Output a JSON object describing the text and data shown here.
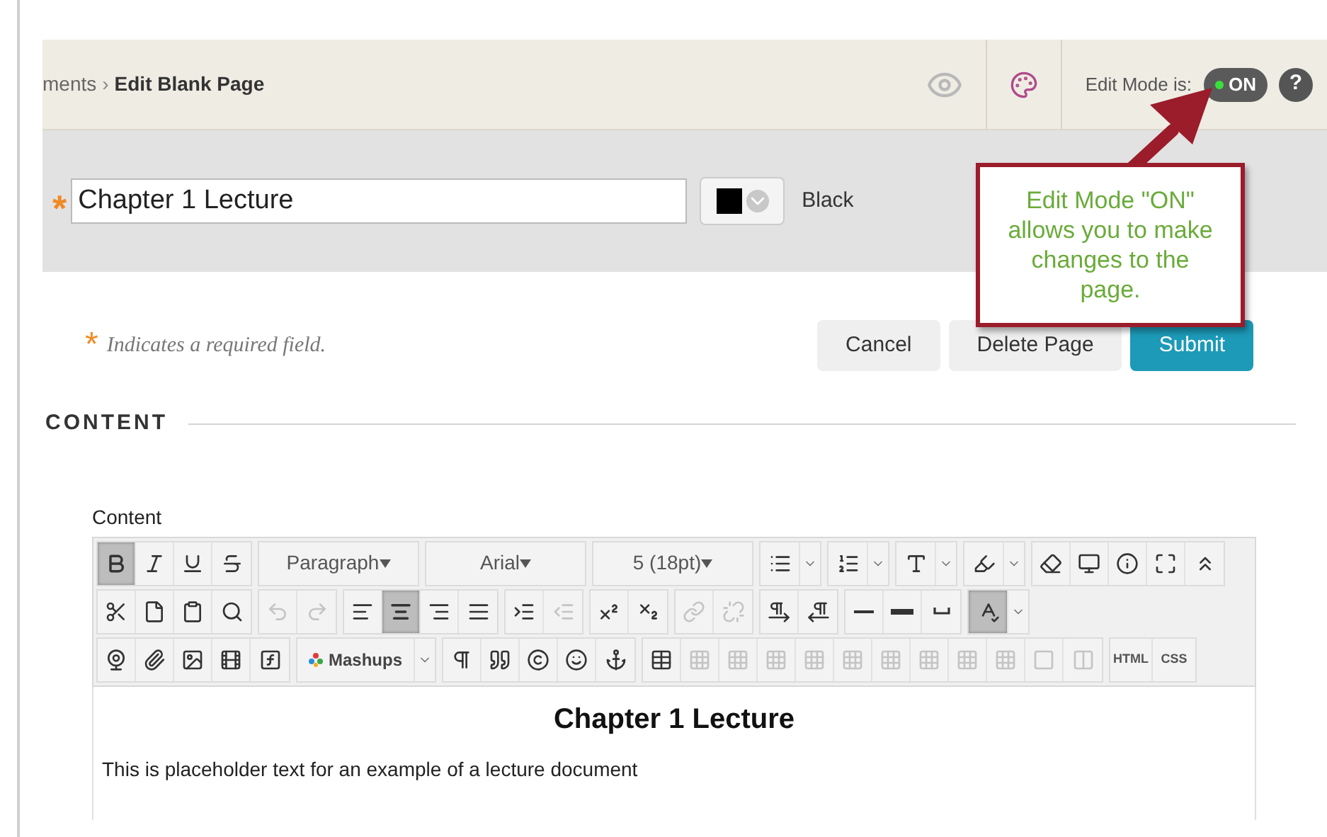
{
  "breadcrumb": {
    "parent": "ments",
    "separator": "›",
    "current": "Edit Blank Page"
  },
  "edit_mode": {
    "label": "Edit Mode is:",
    "on": true,
    "state_text": "ON"
  },
  "help": "?",
  "title_field": {
    "required_mark": "*",
    "value": "Chapter 1 Lecture"
  },
  "color_picker": {
    "color": "#000000",
    "label": "Black"
  },
  "required_note": {
    "mark": "*",
    "text": "Indicates a required field."
  },
  "buttons": [
    {
      "label": "Cancel",
      "kind": "secondary"
    },
    {
      "label": "Delete Page",
      "kind": "secondary"
    },
    {
      "label": "Submit",
      "kind": "primary"
    }
  ],
  "section_heading": "CONTENT",
  "editor": {
    "label": "Content",
    "toolbar": [
      [
        [
          {
            "kind": "icon",
            "pressed": true,
            "disabled": false
          },
          {
            "kind": "icon",
            "pressed": false,
            "disabled": false
          },
          {
            "kind": "icon",
            "pressed": false,
            "disabled": false
          },
          {
            "kind": "icon",
            "pressed": false,
            "disabled": false
          }
        ],
        [
          {
            "kind": "select",
            "label": "Paragraph"
          }
        ],
        [
          {
            "kind": "select",
            "label": "Arial"
          }
        ],
        [
          {
            "kind": "select",
            "label": "5 (18pt)"
          }
        ],
        [
          {
            "kind": "split",
            "pressed": false
          }
        ],
        [
          {
            "kind": "split",
            "pressed": false
          }
        ],
        [
          {
            "kind": "split",
            "pressed": false
          }
        ],
        [
          {
            "kind": "split",
            "pressed": false
          }
        ],
        [
          {
            "kind": "icon",
            "pressed": false,
            "disabled": false
          },
          {
            "kind": "icon",
            "pressed": false,
            "disabled": false
          },
          {
            "kind": "icon",
            "pressed": false,
            "disabled": false
          },
          {
            "kind": "icon",
            "pressed": false,
            "disabled": false
          },
          {
            "kind": "icon",
            "pressed": false,
            "disabled": false
          }
        ]
      ],
      [
        [
          {
            "kind": "icon",
            "pressed": false,
            "disabled": false
          },
          {
            "kind": "icon",
            "pressed": false,
            "disabled": false
          },
          {
            "kind": "icon",
            "pressed": false,
            "disabled": false
          },
          {
            "kind": "icon",
            "pressed": false,
            "disabled": false
          }
        ],
        [
          {
            "kind": "icon",
            "pressed": false,
            "disabled": true
          },
          {
            "kind": "icon",
            "pressed": false,
            "disabled": true
          }
        ],
        [
          {
            "kind": "icon",
            "pressed": false,
            "disabled": false
          },
          {
            "kind": "icon",
            "pressed": true,
            "disabled": false
          },
          {
            "kind": "icon",
            "pressed": false,
            "disabled": false
          },
          {
            "kind": "icon",
            "pressed": false,
            "disabled": false
          }
        ],
        [
          {
            "kind": "icon",
            "pressed": false,
            "disabled": false
          },
          {
            "kind": "icon",
            "pressed": false,
            "disabled": true
          }
        ],
        [
          {
            "kind": "icon",
            "pressed": false,
            "disabled": false
          },
          {
            "kind": "icon",
            "pressed": false,
            "disabled": false
          }
        ],
        [
          {
            "kind": "icon",
            "pressed": false,
            "disabled": true
          },
          {
            "kind": "icon",
            "pressed": false,
            "disabled": true
          }
        ],
        [
          {
            "kind": "icon",
            "pressed": false,
            "disabled": false
          },
          {
            "kind": "icon",
            "pressed": false,
            "disabled": false
          }
        ],
        [
          {
            "kind": "icon",
            "pressed": false,
            "disabled": false
          },
          {
            "kind": "icon",
            "pressed": false,
            "disabled": false
          },
          {
            "kind": "icon",
            "pressed": false,
            "disabled": false
          }
        ],
        [
          {
            "kind": "split",
            "pressed": true
          }
        ]
      ],
      [
        [
          {
            "kind": "icon",
            "pressed": false,
            "disabled": false
          },
          {
            "kind": "icon",
            "pressed": false,
            "disabled": false
          },
          {
            "kind": "icon",
            "pressed": false,
            "disabled": false
          },
          {
            "kind": "icon",
            "pressed": false,
            "disabled": false
          },
          {
            "kind": "icon",
            "pressed": false,
            "disabled": false
          }
        ],
        [
          {
            "kind": "split",
            "pressed": false,
            "label": "Mashups"
          }
        ],
        [
          {
            "kind": "icon",
            "pressed": false,
            "disabled": false
          },
          {
            "kind": "icon",
            "pressed": false,
            "disabled": false
          },
          {
            "kind": "icon",
            "pressed": false,
            "disabled": false
          },
          {
            "kind": "icon",
            "pressed": false,
            "disabled": false
          },
          {
            "kind": "icon",
            "pressed": false,
            "disabled": false
          }
        ],
        [
          {
            "kind": "icon",
            "pressed": false,
            "disabled": false
          },
          {
            "kind": "icon",
            "pressed": false,
            "disabled": true
          },
          {
            "kind": "icon",
            "pressed": false,
            "disabled": true
          },
          {
            "kind": "icon",
            "pressed": false,
            "disabled": true
          },
          {
            "kind": "icon",
            "pressed": false,
            "disabled": true
          },
          {
            "kind": "icon",
            "pressed": false,
            "disabled": true
          },
          {
            "kind": "icon",
            "pressed": false,
            "disabled": true
          },
          {
            "kind": "icon",
            "pressed": false,
            "disabled": true
          },
          {
            "kind": "icon",
            "pressed": false,
            "disabled": true
          },
          {
            "kind": "icon",
            "pressed": false,
            "disabled": true
          },
          {
            "kind": "icon",
            "pressed": false,
            "disabled": true
          },
          {
            "kind": "icon",
            "pressed": false,
            "disabled": true
          }
        ],
        [
          {
            "kind": "text",
            "label": "HTML"
          },
          {
            "kind": "text",
            "label": "CSS"
          }
        ]
      ]
    ],
    "heading": "Chapter 1 Lecture",
    "paragraph": "This is placeholder text for an example of a lecture document"
  },
  "callout": {
    "text": "Edit Mode \"ON\" allows you to make changes to the page."
  }
}
